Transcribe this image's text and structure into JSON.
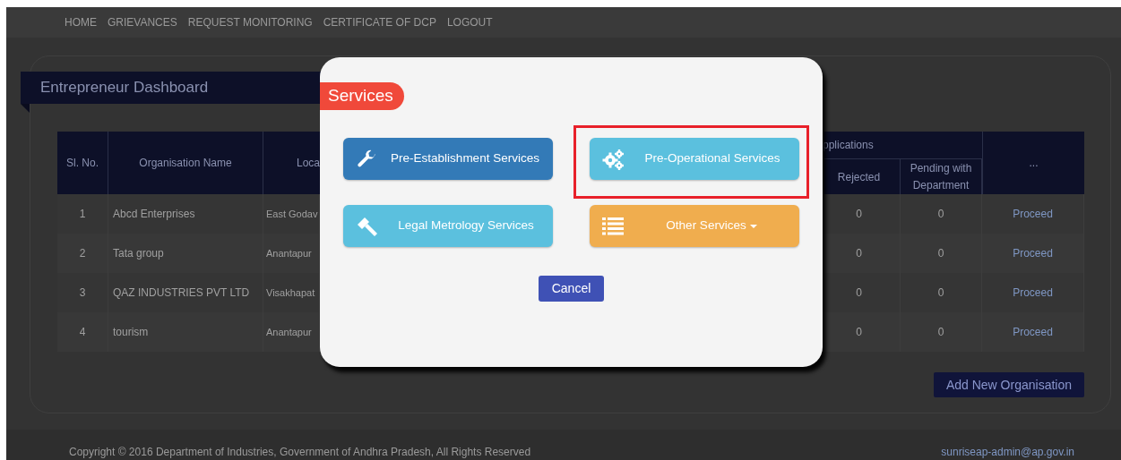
{
  "nav": [
    {
      "label": "HOME"
    },
    {
      "label": "GRIEVANCES"
    },
    {
      "label": "REQUEST MONITORING"
    },
    {
      "label": "CERTIFICATE OF DCP"
    },
    {
      "label": "LOGOUT"
    }
  ],
  "dashboard": {
    "title": "Entrepreneur Dashboard"
  },
  "table": {
    "group_header": "pplications",
    "columns": [
      "Sl. No.",
      "Organisation Name",
      "Loca",
      "Rejected",
      "Pending with Department",
      "..."
    ],
    "rows": [
      [
        "1",
        "Abcd Enterprises",
        "East Godav",
        "0",
        "0",
        "Proceed"
      ],
      [
        "2",
        "Tata group",
        "Anantapur",
        "0",
        "0",
        "Proceed"
      ],
      [
        "3",
        "QAZ INDUSTRIES PVT LTD",
        "Visakhapat",
        "0",
        "0",
        "Proceed"
      ],
      [
        "4",
        "tourism",
        "Anantapur",
        "0",
        "0",
        "Proceed"
      ]
    ]
  },
  "add_button": "Add New Organisation",
  "footer": {
    "copyright": "Copyright © 2016 Department of Industries, Government of Andhra Pradesh, All Rights Reserved",
    "email": "sunriseap-admin@ap.gov.in"
  },
  "modal": {
    "title": "Services",
    "buttons": [
      {
        "label": "Pre-Establishment Services",
        "kind": "wrench",
        "color": "#337ab7",
        "highlighted": false,
        "dropdown": false
      },
      {
        "label": "Pre-Operational Services",
        "kind": "gears",
        "color": "#5bc0de",
        "highlighted": true,
        "dropdown": false
      },
      {
        "label": "Legal Metrology Services",
        "kind": "gavel",
        "color": "#5bc0de",
        "highlighted": false,
        "dropdown": false
      },
      {
        "label": "Other Services",
        "kind": "list",
        "color": "#f0ad4e",
        "highlighted": false,
        "dropdown": true
      }
    ],
    "cancel": "Cancel"
  }
}
